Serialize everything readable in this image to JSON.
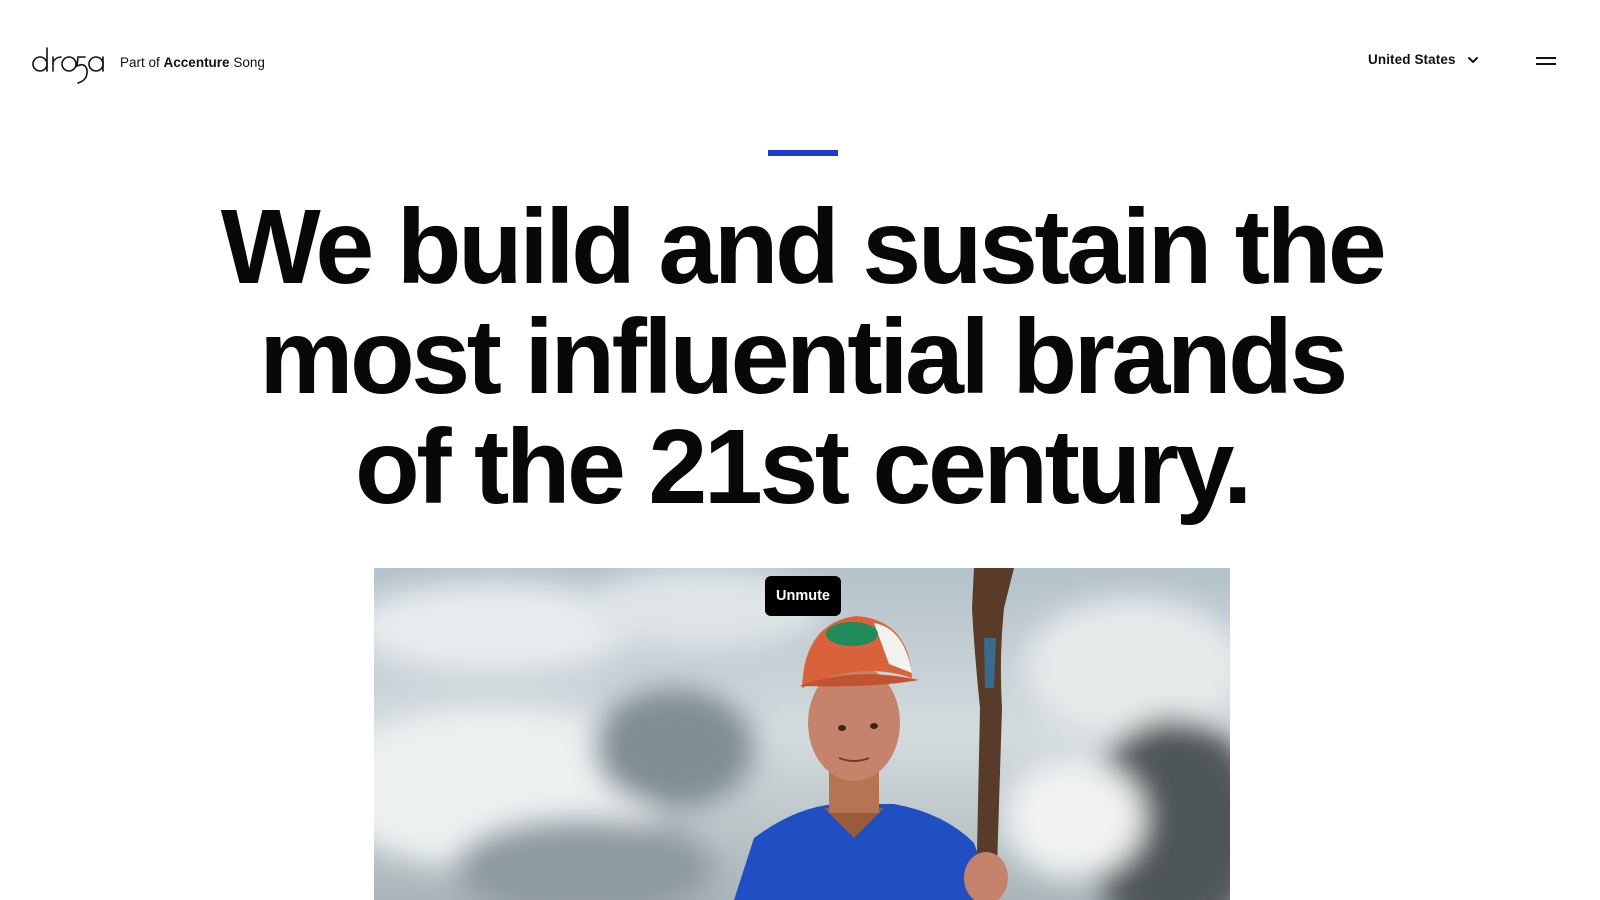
{
  "header": {
    "logo_text": "drosa",
    "tagline": {
      "prefix": "Part of",
      "brand": "Accenture",
      "suffix": "Song"
    },
    "country_selector": {
      "label": "United States",
      "icon": "chevron-down-icon"
    },
    "menu_icon": "hamburger-menu-icon"
  },
  "colors": {
    "accent": "#1a3cc8",
    "text": "#0a0a0a",
    "background": "#ffffff",
    "button_bg": "#000000"
  },
  "hero": {
    "headline": "We build and sustain the most influential brands of the 21st century."
  },
  "video": {
    "unmute_label": "Unmute"
  }
}
